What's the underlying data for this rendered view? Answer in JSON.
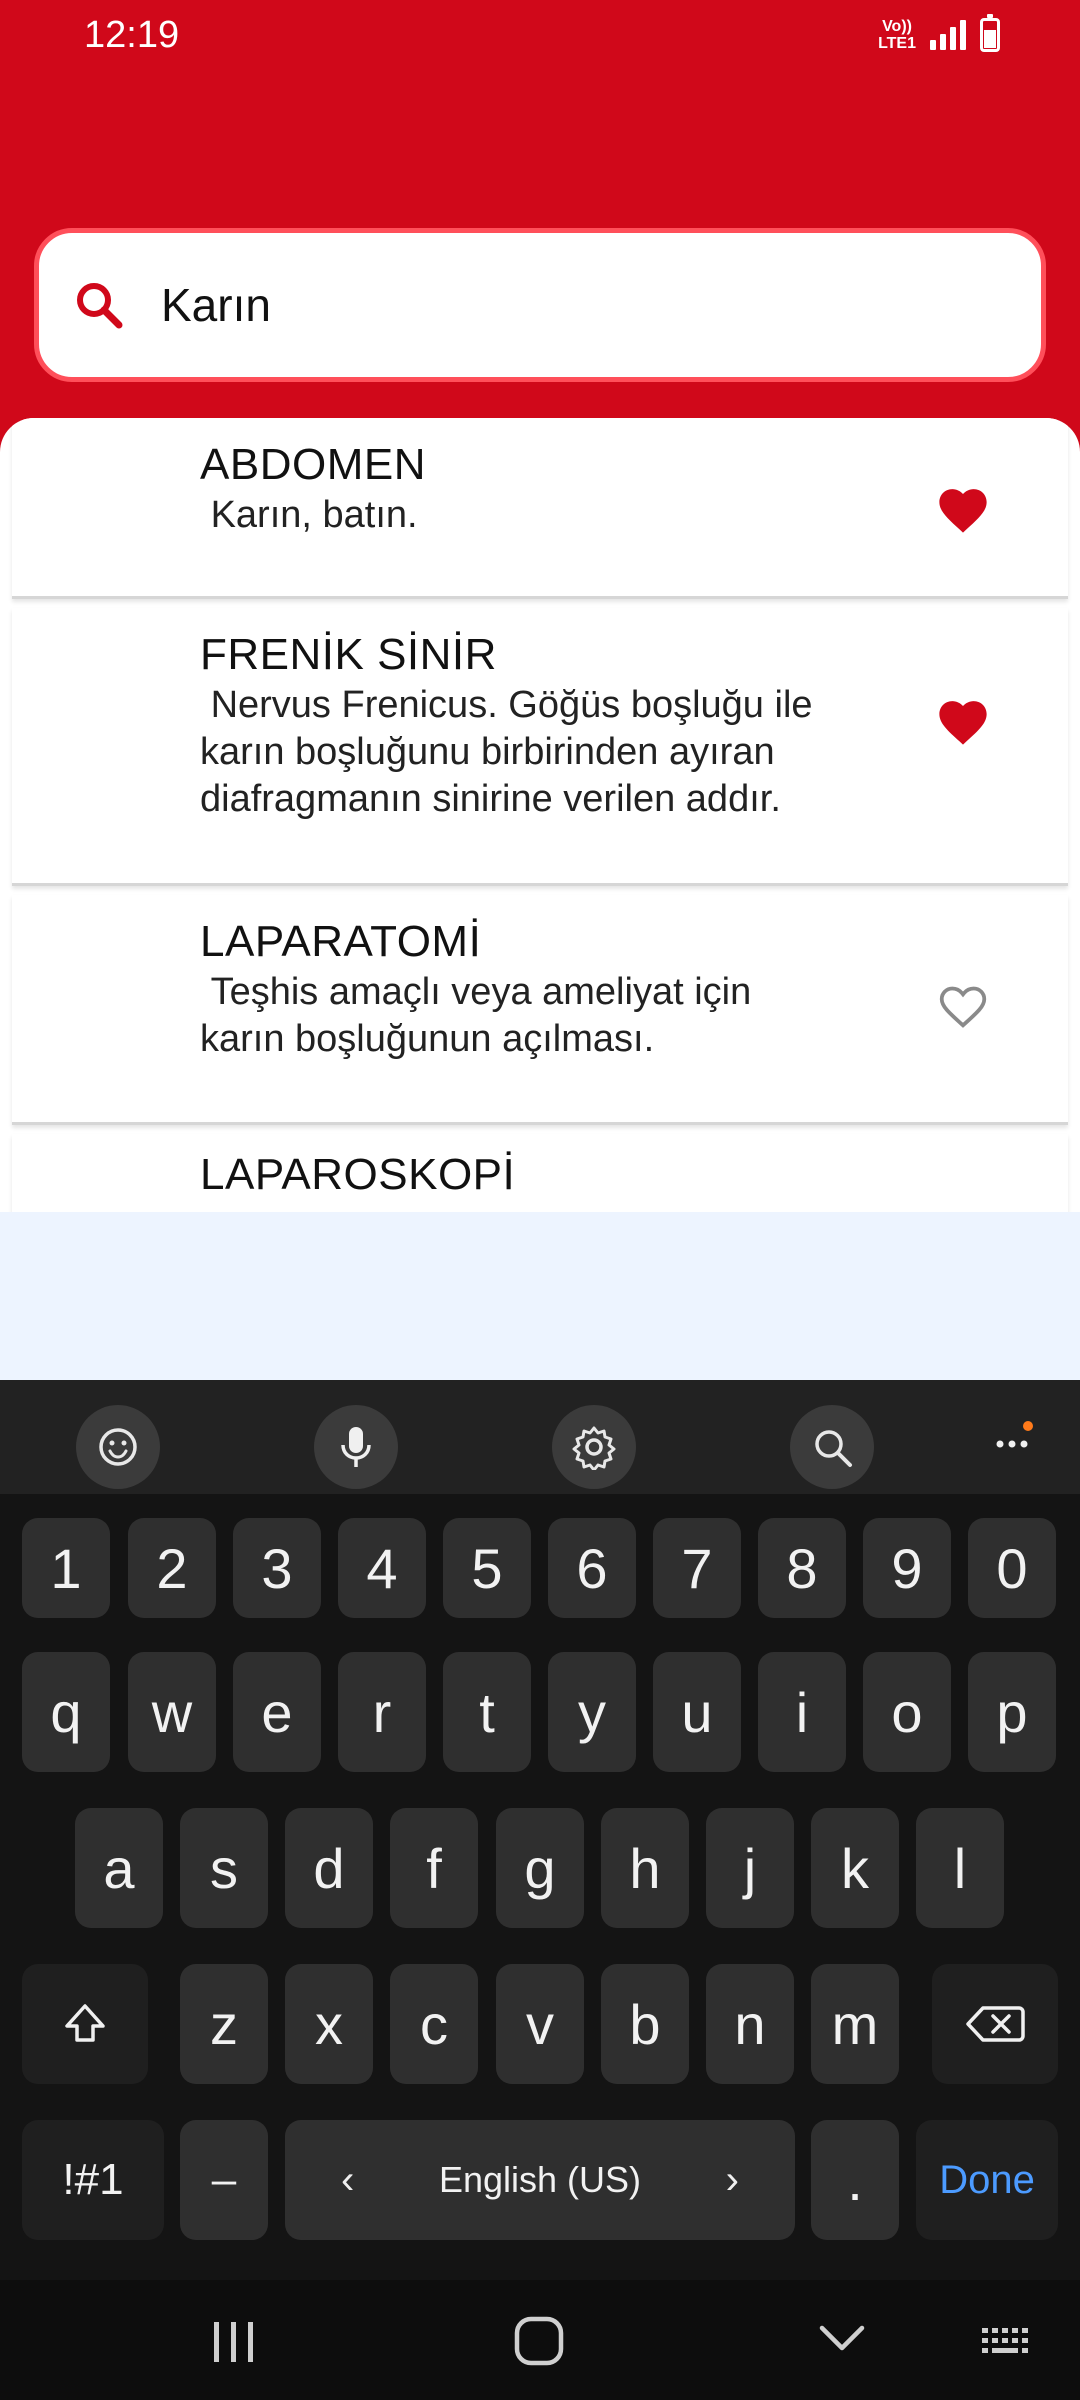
{
  "status_bar": {
    "time": "12:19",
    "network": "Vo)) LTE1"
  },
  "search": {
    "value": "Karın"
  },
  "results": [
    {
      "title": "ABDOMEN",
      "description": " Karın, batın.",
      "favorite": true
    },
    {
      "title": "FRENİK SİNİR",
      "description": " Nervus Frenicus. Göğüs boşluğu ile\nkarın boşluğunu birbirinden ayıran\ndiafragmanın sinirine verilen addır.",
      "favorite": true
    },
    {
      "title": "LAPARATOMİ",
      "description": " Teşhis amaçlı veya ameliyat için\nkarın boşluğunun açılması.",
      "favorite": false
    },
    {
      "title": "LAPAROSKOPİ",
      "description": "",
      "favorite": false
    }
  ],
  "keyboard": {
    "toolbar_icons": [
      "emoji-icon",
      "microphone-icon",
      "gear-icon",
      "search-icon",
      "more-icon"
    ],
    "number_row": [
      "1",
      "2",
      "3",
      "4",
      "5",
      "6",
      "7",
      "8",
      "9",
      "0"
    ],
    "row1": [
      "q",
      "w",
      "e",
      "r",
      "t",
      "y",
      "u",
      "i",
      "o",
      "p"
    ],
    "row2": [
      "a",
      "s",
      "d",
      "f",
      "g",
      "h",
      "j",
      "k",
      "l"
    ],
    "row3": [
      "z",
      "x",
      "c",
      "v",
      "b",
      "n",
      "m"
    ],
    "symbols_label": "!#1",
    "dash_label": "–",
    "space_label": "English (US)",
    "period_label": ".",
    "done_label": "Done"
  },
  "colors": {
    "header": "#d0081a",
    "search_border": "#ff4f5a",
    "heart_filled": "#d0081a",
    "heart_outline": "#8a8a8a",
    "done": "#4c9bff"
  }
}
